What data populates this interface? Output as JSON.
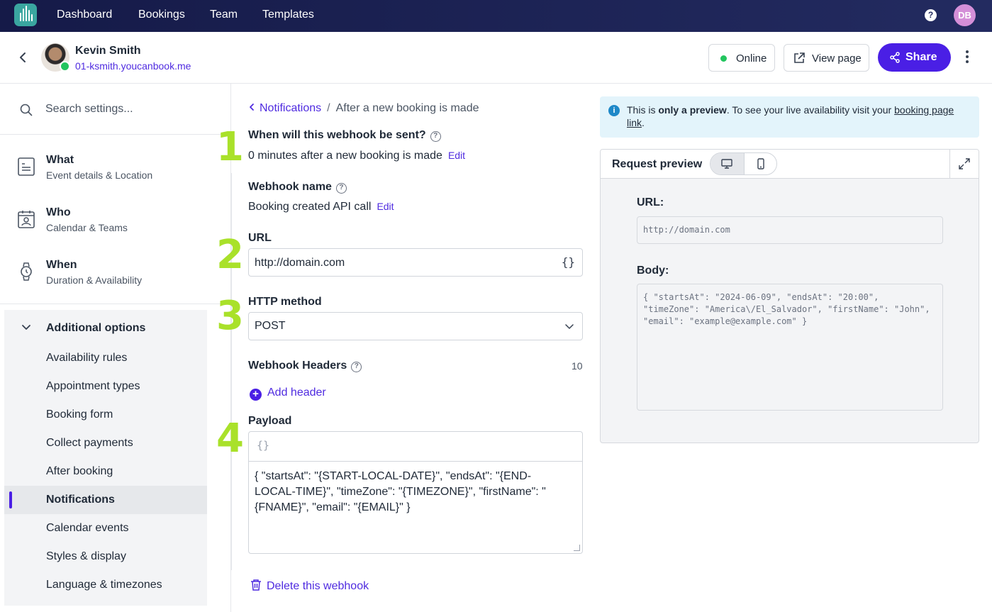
{
  "nav": {
    "items": [
      "Dashboard",
      "Bookings",
      "Team",
      "Templates"
    ],
    "help_label": "?",
    "user_initials": "DB"
  },
  "header": {
    "name": "Kevin Smith",
    "url": "01-ksmith.youcanbook.me",
    "status_label": "Online",
    "view_page_label": "View page",
    "share_label": "Share"
  },
  "sidebar": {
    "search_placeholder": "Search settings...",
    "main_items": [
      {
        "title": "What",
        "subtitle": "Event details & Location"
      },
      {
        "title": "Who",
        "subtitle": "Calendar & Teams"
      },
      {
        "title": "When",
        "subtitle": "Duration & Availability"
      }
    ],
    "additional_label": "Additional options",
    "sub_items": [
      "Availability rules",
      "Appointment types",
      "Booking form",
      "Collect payments",
      "After booking",
      "Notifications",
      "Calendar events",
      "Styles & display",
      "Language & timezones"
    ],
    "active_sub_item": "Notifications"
  },
  "breadcrumb": {
    "parent": "Notifications",
    "separator": "/",
    "current": "After a new booking is made"
  },
  "steps": [
    "1",
    "2",
    "3",
    "4"
  ],
  "form": {
    "when_label": "When will this webhook be sent?",
    "when_value": "0 minutes after a new booking is made",
    "edit_label": "Edit",
    "name_label": "Webhook name",
    "name_value": "Booking created API call",
    "url_label": "URL",
    "url_value": "http://domain.com",
    "url_braces": "{}",
    "method_label": "HTTP method",
    "method_value": "POST",
    "headers_label": "Webhook Headers",
    "headers_count": "10",
    "add_header_label": "Add header",
    "payload_label": "Payload",
    "payload_braces": "{}",
    "payload_value": "{ \"startsAt\": \"{START-LOCAL-DATE}\", \"endsAt\": \"{END-LOCAL-TIME}\", \"timeZone\": \"{TIMEZONE}\", \"firstName\": \"{FNAME}\", \"email\": \"{EMAIL}\" }",
    "delete_label": "Delete this webhook"
  },
  "preview": {
    "info_prefix": "This is ",
    "info_bold": "only a preview",
    "info_middle": ". To see your live availability visit your ",
    "info_link": "booking page link",
    "info_suffix": ".",
    "title": "Request preview",
    "url_label": "URL:",
    "url_value": "http://domain.com",
    "body_label": "Body:",
    "body_value": "{ \"startsAt\": \"2024-06-09\", \"endsAt\": \"20:00\", \"timeZone\": \"America\\/El_Salvador\", \"firstName\": \"John\", \"email\": \"example@example.com\" }"
  },
  "colors": {
    "accent": "#4a1fe5",
    "nav_bg": "#1b2150",
    "step_number": "#a9e12a",
    "online": "#22c55e"
  }
}
